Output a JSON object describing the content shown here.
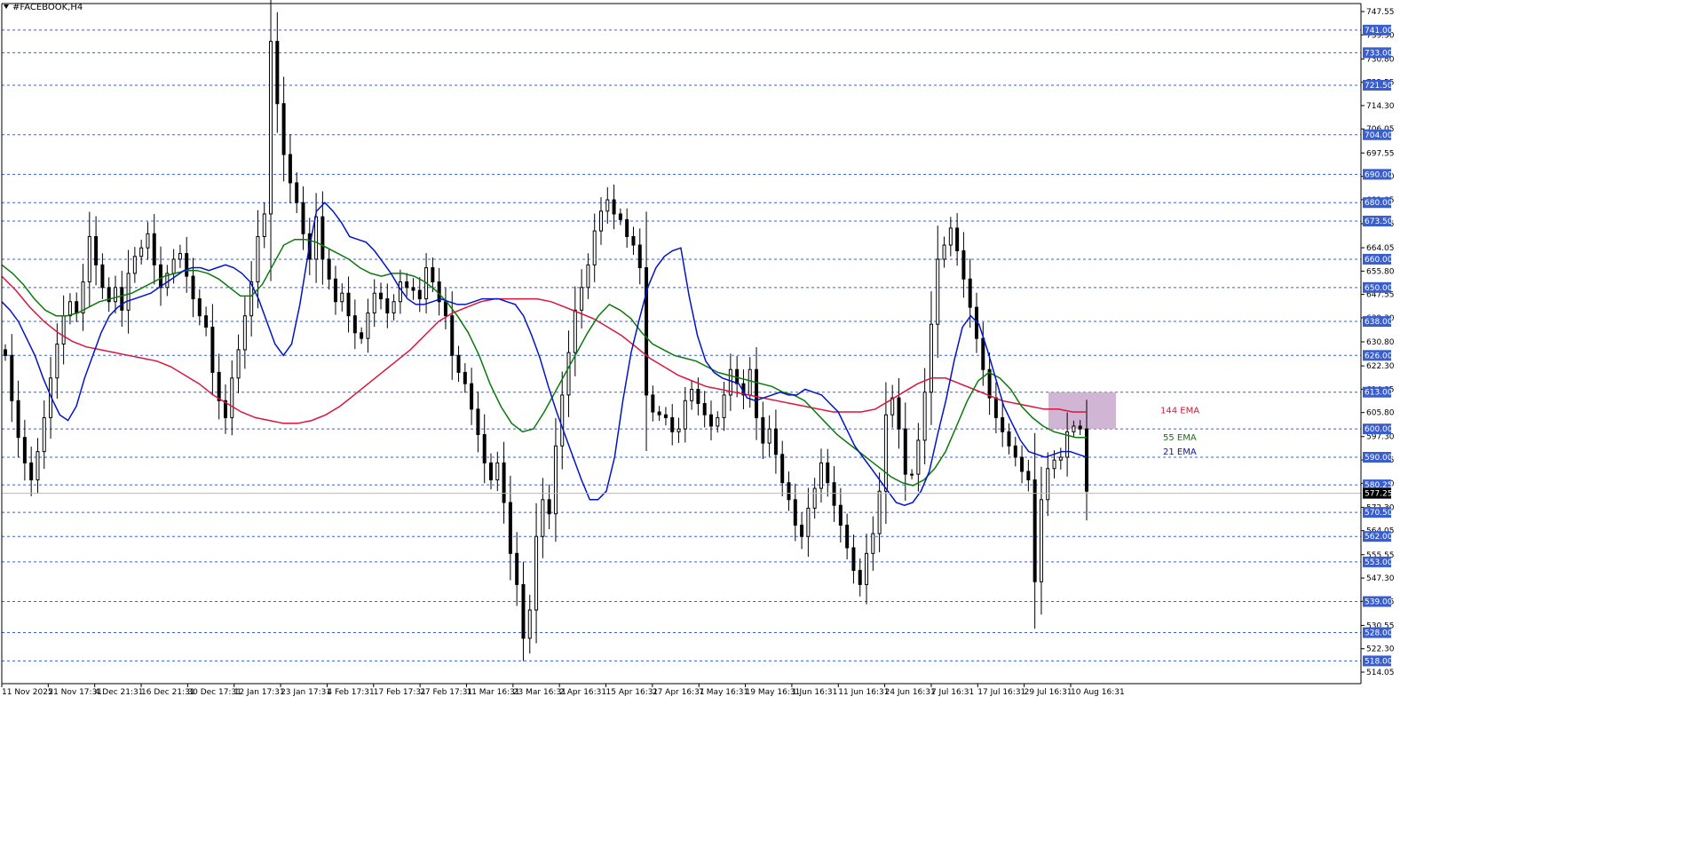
{
  "header": {
    "symbol": "#FACEBOOK,H4"
  },
  "chart_data": {
    "type": "candlestick",
    "symbol": "#FACEBOOK,H4",
    "ylim": [
      514.05,
      751
    ],
    "y_ticks": [
      "747.55",
      "739.30",
      "730.80",
      "722.55",
      "714.30",
      "706.05",
      "697.55",
      "689.30",
      "681.05",
      "672.55",
      "664.05",
      "655.80",
      "647.55",
      "639.30",
      "630.80",
      "622.30",
      "614.05",
      "605.80",
      "597.30",
      "589.05",
      "580.80",
      "572.30",
      "564.05",
      "555.55",
      "547.30",
      "539.05",
      "530.55",
      "522.30",
      "514.05"
    ],
    "levels": [
      "741.00",
      "733.00",
      "721.50",
      "704.00",
      "690.00",
      "680.00",
      "673.50",
      "660.00",
      "650.00",
      "638.00",
      "626.00",
      "613.00",
      "600.00",
      "590.00",
      "580.25",
      "570.50",
      "562.00",
      "553.00",
      "539.00",
      "528.00",
      "518.00"
    ],
    "current_price": "577.25",
    "x_labels": [
      "11 Nov 2025",
      "21 Nov 17:31",
      "4 Dec 21:31",
      "16 Dec 21:31",
      "30 Dec 17:31",
      "12 Jan 17:31",
      "23 Jan 17:31",
      "4 Feb 17:31",
      "17 Feb 17:31",
      "27 Feb 17:31",
      "11 Mar 16:31",
      "23 Mar 16:31",
      "2 Apr 16:31",
      "15 Apr 16:31",
      "27 Apr 16:31",
      "7 May 16:31",
      "19 May 16:31",
      "1 Jun 16:31",
      "11 Jun 16:31",
      "24 Jun 16:31",
      "7 Jul 16:31",
      "17 Jul 16:31",
      "29 Jul 16:31",
      "10 Aug 16:31"
    ],
    "closes": [
      626,
      610,
      597,
      588,
      582,
      592,
      604,
      618,
      630,
      640,
      645,
      641,
      652,
      668,
      658,
      650,
      645,
      650,
      642,
      655,
      661,
      664,
      669,
      658,
      650,
      655,
      660,
      662,
      654,
      646,
      640,
      636,
      620,
      610,
      604,
      618,
      628,
      640,
      652,
      668,
      676,
      737,
      715,
      697,
      687,
      680,
      669,
      660,
      675,
      660,
      653,
      645,
      648,
      640,
      634,
      632,
      641,
      648,
      646,
      641,
      645,
      652,
      650,
      649,
      646,
      657,
      652,
      645,
      640,
      626,
      620,
      616,
      607,
      598,
      588,
      582,
      588,
      574,
      556,
      545,
      526,
      536,
      562,
      575,
      570,
      594,
      612,
      627,
      642,
      650,
      658,
      670,
      677,
      681,
      676,
      674,
      668,
      665,
      657,
      612,
      606,
      605,
      604,
      599,
      600,
      610,
      614,
      609,
      605,
      601,
      604,
      612,
      621,
      616,
      612,
      621,
      604,
      595,
      600,
      591,
      581,
      575,
      566,
      562,
      572,
      579,
      588,
      581,
      573,
      566,
      558,
      550,
      545,
      556,
      563,
      578,
      605,
      611,
      600,
      584,
      584,
      596,
      613,
      637,
      660,
      665,
      671,
      663,
      653,
      643,
      632,
      621,
      611,
      604,
      599,
      594,
      590,
      585,
      582,
      546,
      575,
      586,
      589,
      590,
      599,
      601,
      600,
      578
    ],
    "ema21": [
      645,
      642,
      638,
      632,
      626,
      618,
      611,
      605,
      603,
      608,
      618,
      626,
      634,
      640,
      643,
      645,
      646,
      647,
      648,
      650,
      652,
      654,
      656,
      657,
      657,
      656,
      657,
      658,
      657,
      655,
      652,
      646,
      638,
      630,
      626,
      630,
      644,
      662,
      677,
      680,
      677,
      673,
      668,
      667,
      666,
      663,
      659,
      655,
      650,
      646,
      644,
      644,
      645,
      646,
      645,
      644,
      644,
      645,
      646,
      646,
      646,
      645,
      644,
      640,
      633,
      625,
      615,
      606,
      598,
      590,
      582,
      575,
      575,
      578,
      590,
      610,
      627,
      639,
      650,
      657,
      661,
      663,
      664,
      647,
      633,
      624,
      620,
      618,
      617,
      616,
      611,
      610,
      611,
      612,
      613,
      612,
      612,
      614,
      613,
      612,
      609,
      606,
      600,
      594,
      590,
      586,
      582,
      578,
      574,
      573,
      574,
      578,
      585,
      598,
      610,
      624,
      636,
      640,
      637,
      628,
      618,
      608,
      602,
      596,
      592,
      591,
      590,
      591,
      592,
      592,
      591,
      590
    ],
    "ema55": [
      658,
      655,
      651,
      646,
      642,
      640,
      640,
      641,
      643,
      645,
      646,
      647,
      648,
      650,
      652,
      654,
      655,
      656,
      656,
      655,
      653,
      650,
      647,
      647,
      651,
      658,
      665,
      667,
      667,
      666,
      664,
      662,
      660,
      657,
      655,
      654,
      655,
      655,
      654,
      652,
      649,
      645,
      640,
      634,
      626,
      616,
      608,
      602,
      599,
      600,
      606,
      613,
      620,
      627,
      634,
      640,
      644,
      642,
      639,
      634,
      630,
      628,
      626,
      625,
      624,
      622,
      620,
      619,
      618,
      617,
      616,
      615,
      613,
      612,
      610,
      606,
      602,
      598,
      595,
      592,
      589,
      586,
      583,
      581,
      580,
      582,
      586,
      592,
      601,
      610,
      617,
      620,
      618,
      614,
      608,
      604,
      601,
      599,
      598,
      597,
      597
    ],
    "ema144": [
      654,
      649,
      643,
      638,
      634,
      631,
      629,
      628,
      627,
      626,
      625,
      624,
      622,
      619,
      616,
      612,
      609,
      606,
      604,
      603,
      602,
      602,
      603,
      605,
      608,
      612,
      616,
      620,
      624,
      628,
      633,
      638,
      641,
      643,
      645,
      646,
      646,
      646,
      646,
      645,
      643,
      641,
      639,
      636,
      633,
      629,
      625,
      622,
      619,
      617,
      615,
      614,
      613,
      612,
      611,
      610,
      609,
      608,
      607,
      606,
      606,
      606,
      607,
      610,
      613,
      616,
      618,
      618,
      616,
      614,
      612,
      610,
      609,
      608,
      607,
      607,
      606,
      606
    ],
    "indicators": [
      "144 EMA",
      "55 EMA",
      "21 EMA"
    ],
    "colors": {
      "candle": "#000000",
      "grid": "#3a5fcd",
      "level_bg": "#3a5fcd",
      "ema21": "#0014c8",
      "ema55": "#0a7a0a",
      "ema144": "#dc143c",
      "zone": "#c8a8cc",
      "price_bg": "#000000"
    }
  }
}
